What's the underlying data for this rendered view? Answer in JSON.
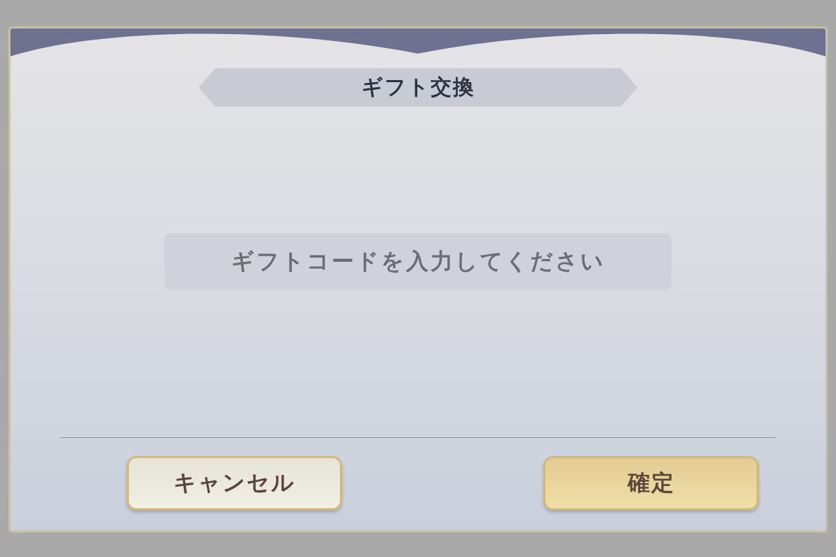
{
  "dialog": {
    "title": "ギフト交換",
    "code_field": {
      "placeholder": "ギフトコードを入力してください"
    },
    "buttons": [
      {
        "label": "キャンセル",
        "kind": "cancel"
      },
      {
        "label": "確定",
        "kind": "confirm"
      }
    ]
  }
}
